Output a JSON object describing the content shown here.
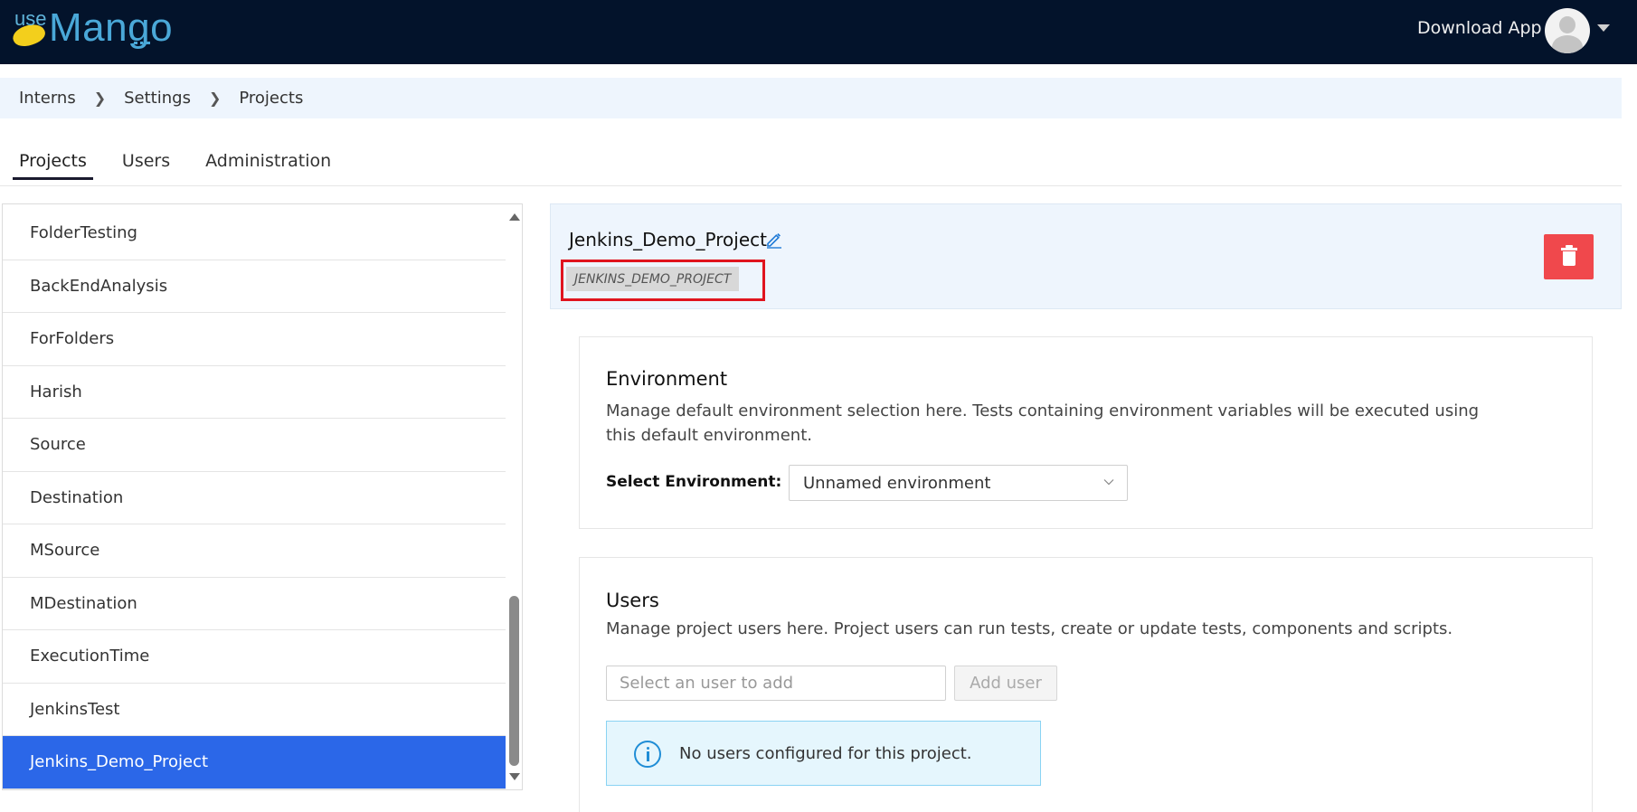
{
  "header": {
    "logo_prefix": "use",
    "logo_name": "Mango",
    "download_app": "Download App"
  },
  "breadcrumb": [
    "Interns",
    "Settings",
    "Projects"
  ],
  "tabs": [
    "Projects",
    "Users",
    "Administration"
  ],
  "active_tab": "Projects",
  "projects": [
    "FolderTesting",
    "BackEndAnalysis",
    "ForFolders",
    "Harish",
    "Source",
    "Destination",
    "MSource",
    "MDestination",
    "ExecutionTime",
    "JenkinsTest",
    "Jenkins_Demo_Project"
  ],
  "selected_project": "Jenkins_Demo_Project",
  "project": {
    "name": "Jenkins_Demo_Project",
    "key": "JENKINS_DEMO_PROJECT"
  },
  "environment": {
    "title": "Environment",
    "description": "Manage default environment selection here. Tests containing environment variables will be executed using this default environment.",
    "select_label": "Select Environment:",
    "selected": "Unnamed environment"
  },
  "users": {
    "title": "Users",
    "description": "Manage project users here. Project users can run tests, create or update tests, components and scripts.",
    "input_placeholder": "Select an user to add",
    "add_button": "Add user",
    "empty_message": "No users configured for this project."
  },
  "colors": {
    "topbar": "#03132b",
    "selected_item": "#2b67e8",
    "delete_button": "#f0484c",
    "highlight_box": "#e0141e",
    "info_icon": "#1f8dd6"
  }
}
